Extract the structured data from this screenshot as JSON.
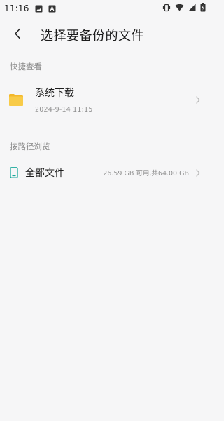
{
  "status_bar": {
    "time": "11:16",
    "left_icons": [
      "image-icon",
      "text-a-icon"
    ],
    "right_icons": [
      "vibrate-icon",
      "wifi-icon",
      "signal-icon",
      "battery-charging-icon"
    ]
  },
  "header": {
    "title": "选择要备份的文件",
    "back_icon": "chevron-left-icon"
  },
  "quick_view": {
    "section_title": "快捷查看",
    "items": [
      {
        "name": "系统下载",
        "time": "2024-9-14 11:15",
        "icon": "folder-icon"
      }
    ]
  },
  "browse_by_path": {
    "section_title": "按路径浏览",
    "items": [
      {
        "label": "全部文件",
        "storage": "26.59 GB 可用,共64.00 GB",
        "icon": "phone-icon"
      }
    ]
  },
  "colors": {
    "background": "#f6f6f7",
    "folder": "#f6c33d",
    "phone_icon": "#19a89b",
    "secondary_text": "#8f8f8f"
  }
}
